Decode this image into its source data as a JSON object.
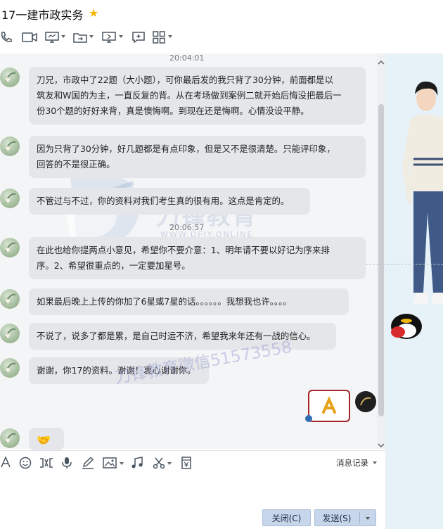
{
  "window": {
    "title": "17一建市政实务"
  },
  "chat": {
    "messages": [
      {
        "timestamp": "20:04:01",
        "text_lines": [
          "刀兄，市政中了22题（大小题），可你最后发的我只背了30分钟，前面都是以",
          "筑友和W国的为主，一直反复的背。从在考场做到案例二就开始后悔没把最后一",
          "份30个题的好好来背，真是懊悔啊。到现在还是悔啊。心情没设平静。"
        ]
      },
      {
        "text_lines": [
          "因为只背了30分钟，好几题都是有点印象，但是又不是很清楚。只能评印象，",
          "回答的不是很正确。"
        ]
      },
      {
        "text_lines": [
          "不管过与不过，你的资料对我们考生真的很有用。这点是肯定的。"
        ]
      },
      {
        "timestamp": "20:06:57",
        "text_lines": [
          "在此也给你提两点小意见，希望你不要介意：1、明年请不要以好记为序来排",
          "序。2、希望很重点的，一定要加星号。"
        ]
      },
      {
        "text_lines": [
          "如果最后晚上上传的你加了6星或7星的话。。。。。。我想我也许。。。。"
        ]
      },
      {
        "text_lines": [
          "不说了，说多了都是累，是自己时运不济，希望我来年还有一战的信心。"
        ]
      },
      {
        "text_lines": [
          "谢谢，你17的资料。谢谢！衷心谢谢你。"
        ]
      },
      {
        "text_lines": []
      }
    ]
  },
  "watermark": {
    "brand": "刀锋教育",
    "url": "WWW.DFJY.ONLINE",
    "wechat": "刀锋教育微信51573558"
  },
  "input": {
    "history_label": "消息记录"
  },
  "buttons": {
    "close_label": "关闭(C)",
    "send_label": "发送(S)"
  },
  "colors": {
    "bubble": "#e4e6e9",
    "side_panel": "#e6f1f8",
    "button": "#c7d6ea",
    "sticker_border": "#a5242c"
  }
}
